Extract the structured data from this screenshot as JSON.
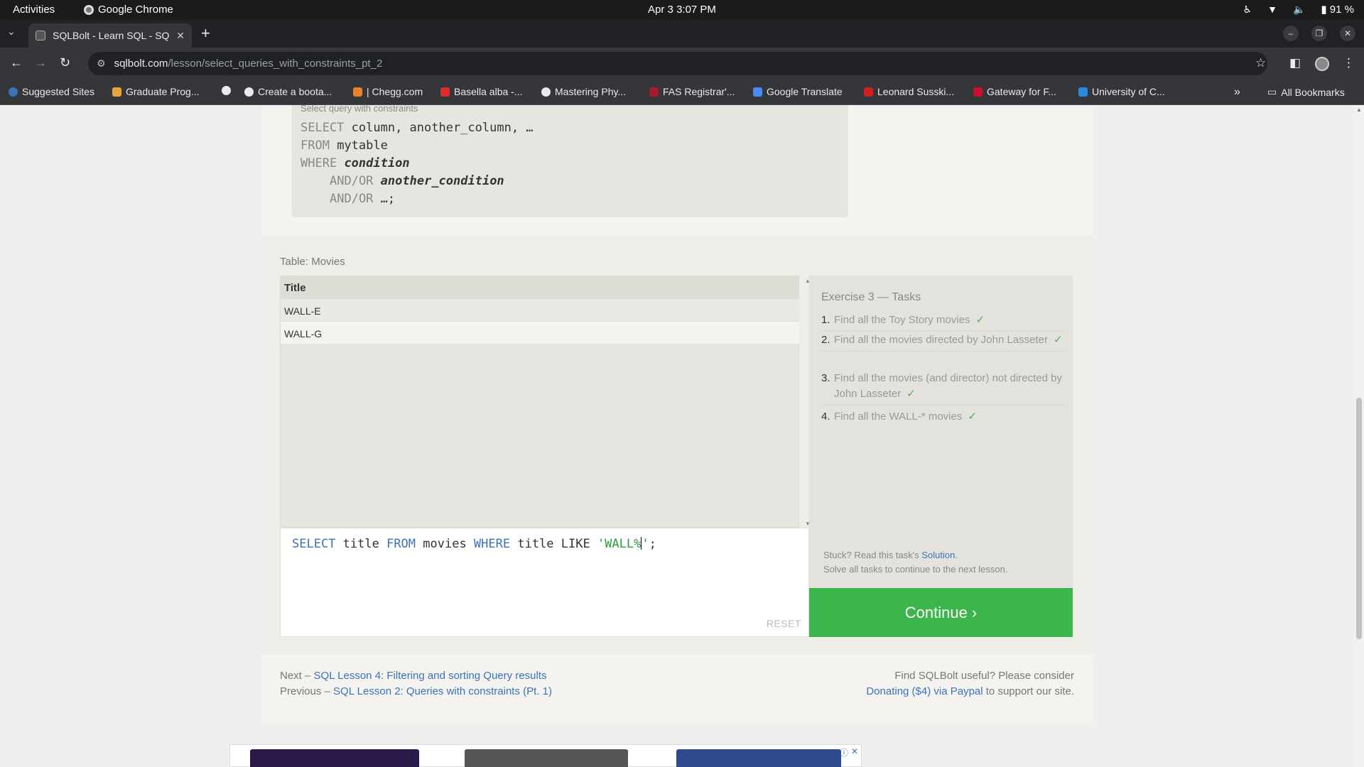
{
  "system": {
    "activities": "Activities",
    "app_name": "Google Chrome",
    "clock": "Apr 3  3:07 PM",
    "battery": "91 %"
  },
  "browser": {
    "tab_title": "SQLBolt - Learn SQL - SQ",
    "url_host": "sqlbolt.com",
    "url_path": "/lesson/select_queries_with_constraints_pt_2",
    "bookmarks": [
      "Suggested Sites",
      "Graduate Prog...",
      "Create a boota...",
      "| Chegg.com",
      "Basella alba -...",
      "Mastering Phy...",
      "FAS Registrar'...",
      "Google Translate",
      "Leonard Susski...",
      "Gateway for F...",
      "University of C..."
    ],
    "bookmarks_overflow": "»",
    "all_bookmarks": "All Bookmarks"
  },
  "lesson": {
    "syntax_caption": "Select query with constraints",
    "syntax": {
      "line1_kw": "SELECT",
      "line1_rest": " column, another_column, …",
      "line2_kw": "FROM",
      "line2_rest": " mytable",
      "line3_kw": "WHERE",
      "line3_rest": "condition",
      "line4_kw": "AND/OR",
      "line4_rest": "another_condition",
      "line5_kw": "AND/OR",
      "line5_rest": " …;"
    },
    "table_label": "Table: Movies",
    "results": {
      "header": "Title",
      "rows": [
        "WALL-E",
        "WALL-G"
      ]
    },
    "query": {
      "t1": "SELECT",
      "t2": " title ",
      "t3": "FROM",
      "t4": " movies ",
      "t5": "WHERE",
      "t6": " title LIKE ",
      "t7": "'WALL%",
      "t8": "'",
      "t9": ";"
    },
    "reset_label": "RESET",
    "tasks": {
      "title_prefix": "Exercise 3 — Tasks",
      "items": [
        {
          "num": "1.",
          "text": "Find all the Toy Story movies",
          "check": "✓"
        },
        {
          "num": "2.",
          "text": "Find all the movies directed by John Lasseter",
          "check": "✓"
        },
        {
          "num": "3.",
          "text": "Find all the movies (and director) not directed by John Lasseter",
          "check": "✓"
        },
        {
          "num": "4.",
          "text": "Find all the WALL-* movies",
          "check": "✓"
        }
      ],
      "stuck_text": "Stuck? Read this task's ",
      "solution_link": "Solution",
      "stuck_period": ".",
      "solve_all": "Solve all tasks to continue to the next lesson."
    },
    "continue_label": "Continue ›",
    "footer": {
      "next_prefix": "Next – ",
      "next_link": "SQL Lesson 4: Filtering and sorting Query results",
      "prev_prefix": "Previous – ",
      "prev_link": "SQL Lesson 2: Queries with constraints (Pt. 1)",
      "useful": "Find SQLBolt useful? Please consider",
      "donate_link": "Donating ($4) via Paypal",
      "donate_suffix": " to support our site."
    }
  }
}
